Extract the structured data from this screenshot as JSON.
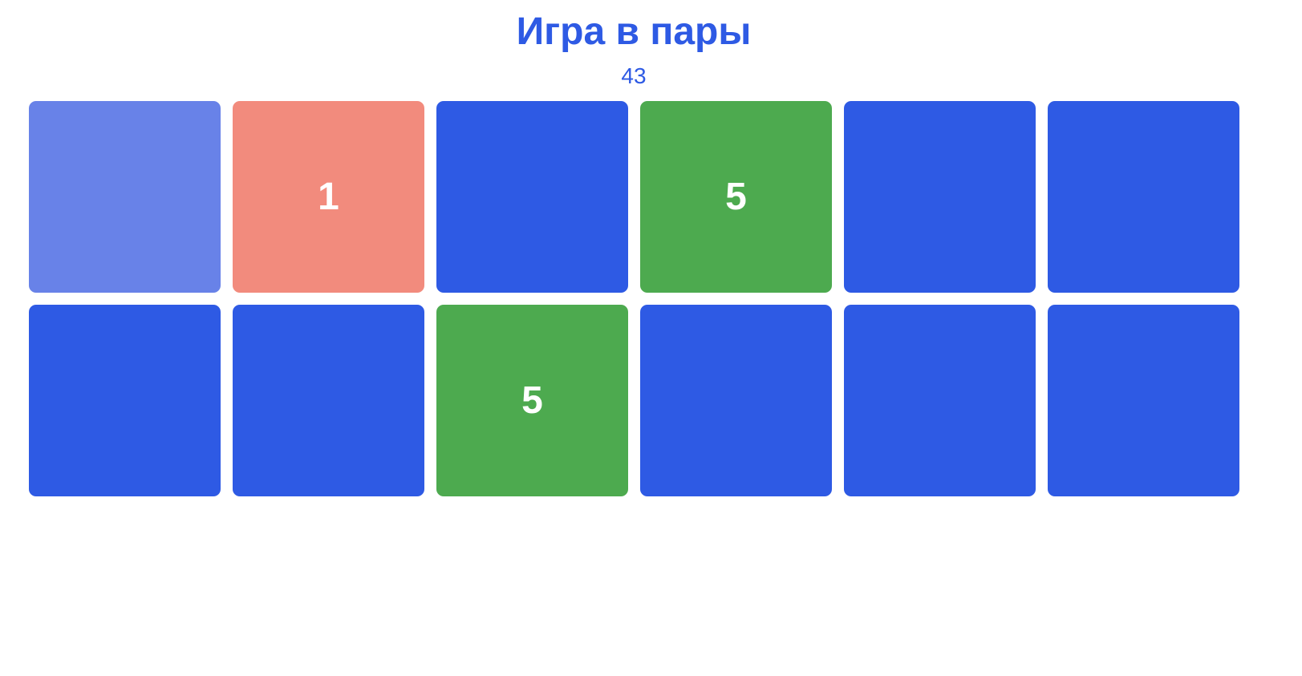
{
  "title": "Игра в пары",
  "counter": "43",
  "colors": {
    "accent": "#2e5ae4",
    "hidden": "#2e5ae4",
    "hover": "#6882e8",
    "wrong": "#f28b7d",
    "matched": "#4daa4f"
  },
  "cards": [
    {
      "state": "hover",
      "value": ""
    },
    {
      "state": "wrong",
      "value": "1"
    },
    {
      "state": "hidden",
      "value": ""
    },
    {
      "state": "matched",
      "value": "5"
    },
    {
      "state": "hidden",
      "value": ""
    },
    {
      "state": "hidden",
      "value": ""
    },
    {
      "state": "hidden",
      "value": ""
    },
    {
      "state": "hidden",
      "value": ""
    },
    {
      "state": "matched",
      "value": "5"
    },
    {
      "state": "hidden",
      "value": ""
    },
    {
      "state": "hidden",
      "value": ""
    },
    {
      "state": "hidden",
      "value": ""
    }
  ]
}
